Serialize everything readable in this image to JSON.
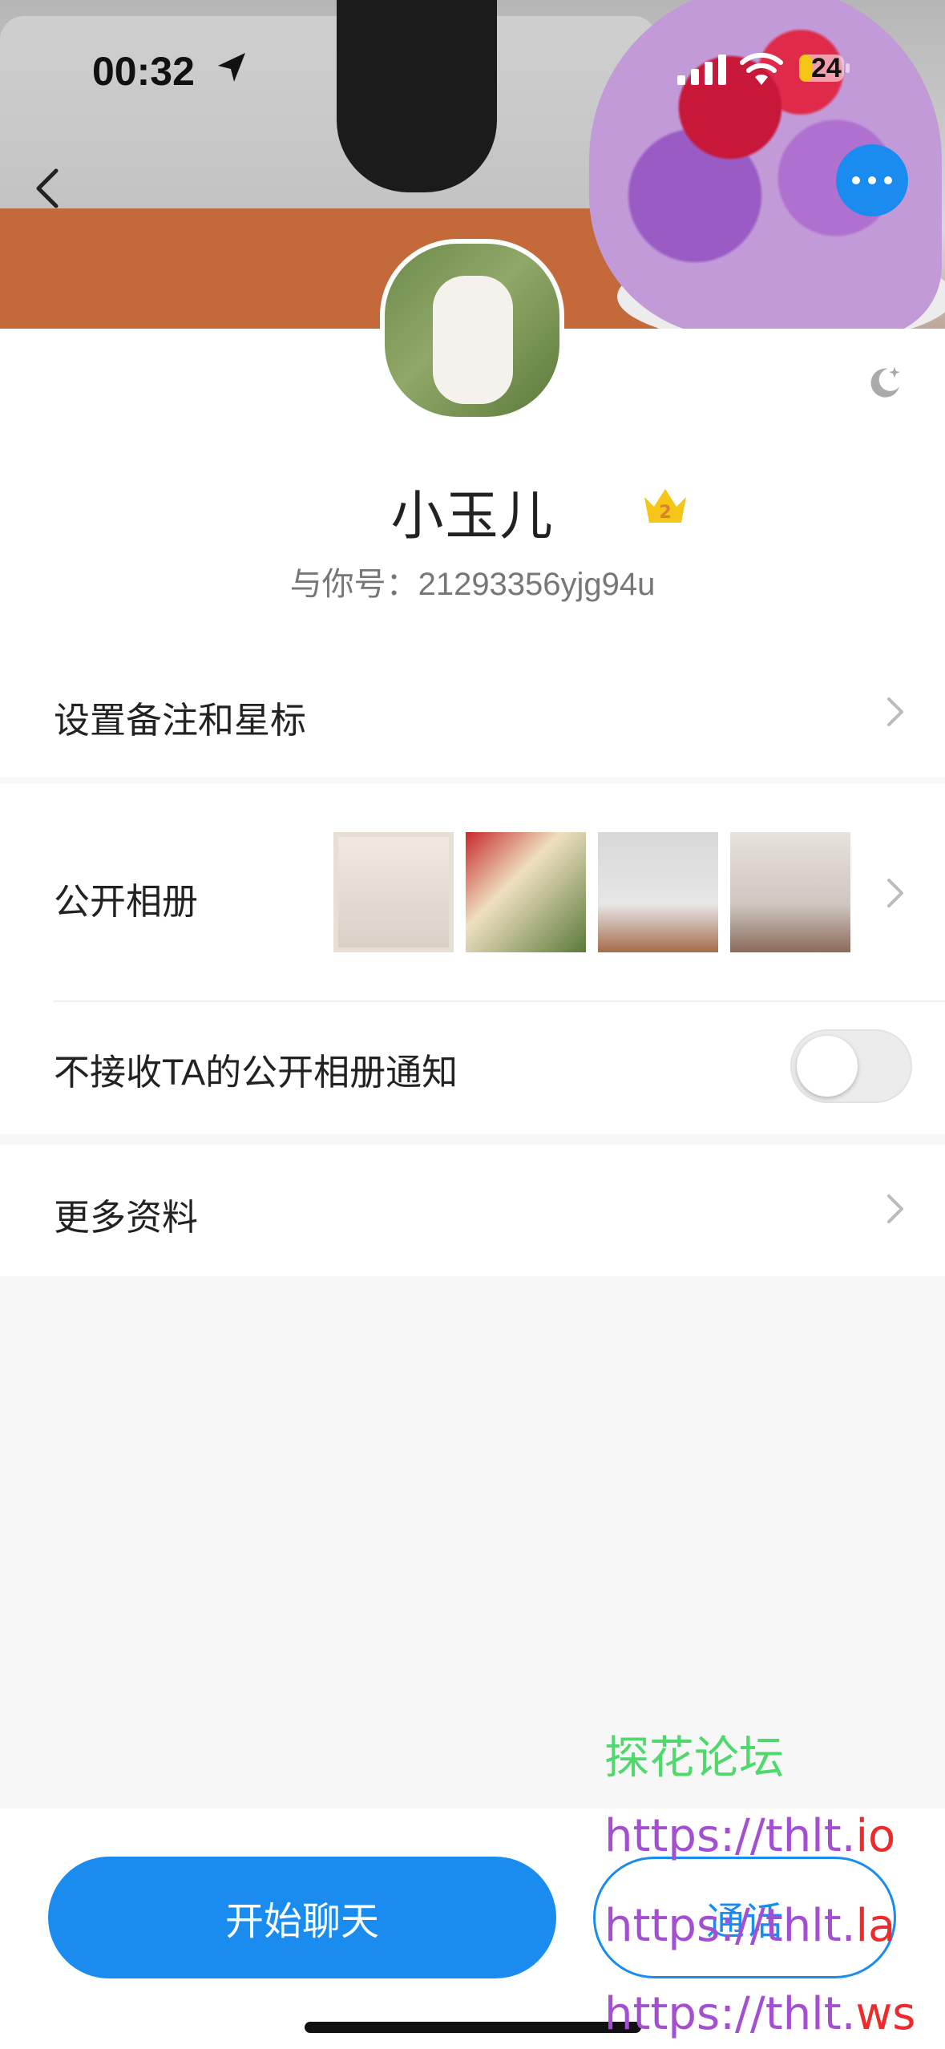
{
  "status_bar": {
    "time": "00:32",
    "battery": "24"
  },
  "profile": {
    "name": "小玉儿",
    "crown_level": "2",
    "id_line": "与你号：21293356yjg94u"
  },
  "rows": {
    "remark": "设置备注和星标",
    "album": "公开相册",
    "album_notify": "不接收TA的公开相册通知",
    "album_notify_on": false,
    "more_info": "更多资料"
  },
  "actions": {
    "start_chat": "开始聊天",
    "call": "通话"
  },
  "watermark": {
    "forum": "探花论坛",
    "links": [
      {
        "prefix": "https://thlt.",
        "suffix": "io"
      },
      {
        "prefix": "https://thlt.",
        "suffix": "la"
      },
      {
        "prefix": "https://thlt.",
        "suffix": "ws"
      }
    ]
  },
  "colors": {
    "accent": "#1a8cf0",
    "crown": "#f5c518",
    "watermark_green": "#4fd86b",
    "watermark_purple": "#a44fd2",
    "watermark_red": "#ee2a2a"
  }
}
